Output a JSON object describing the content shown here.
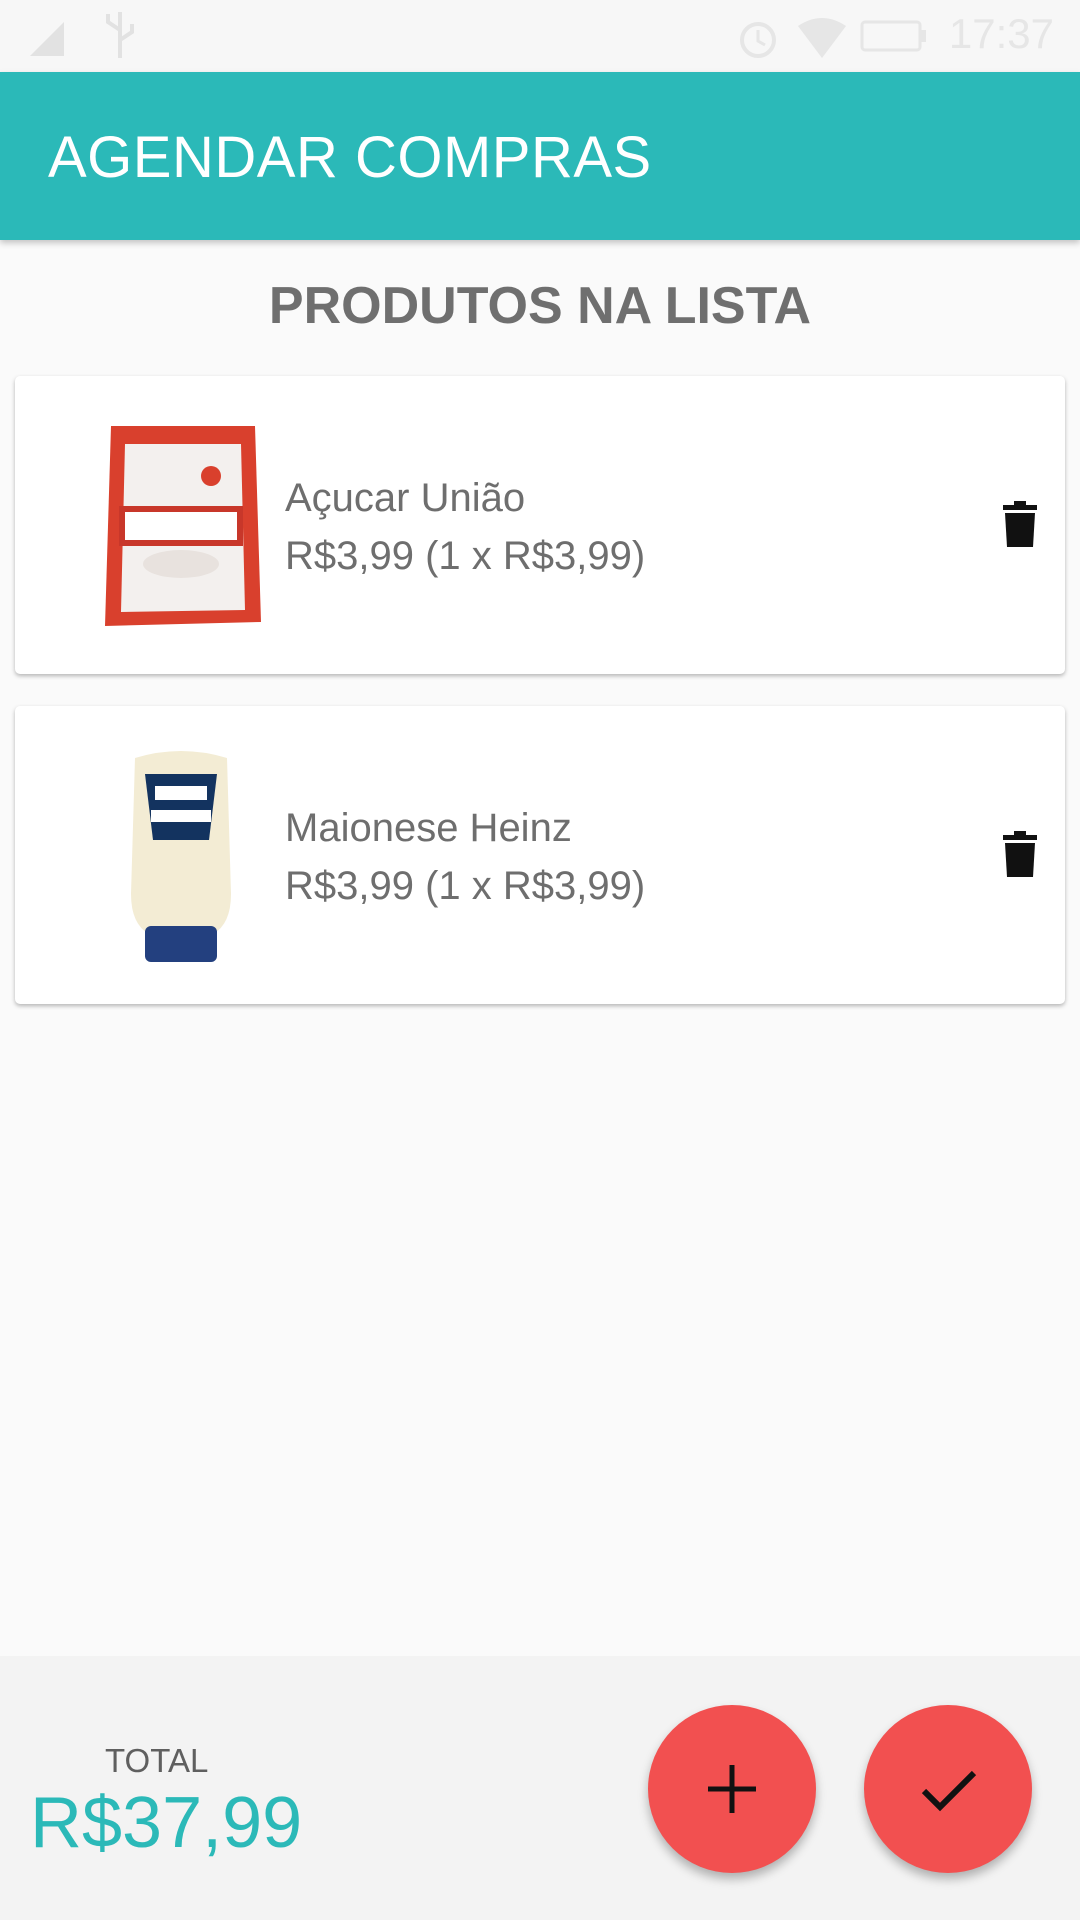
{
  "status_bar": {
    "time": "17:37",
    "icons": [
      "signal-icon",
      "usb-icon",
      "alarm-icon",
      "wifi-icon",
      "battery-icon"
    ]
  },
  "app_bar": {
    "title": "AGENDAR COMPRAS"
  },
  "list": {
    "title": "PRODUTOS NA LISTA",
    "items": [
      {
        "name": "Açucar União",
        "price": "R$3,99 (1 x R$3,99)",
        "image": "sugar-package-image",
        "action_icon": "trash-icon"
      },
      {
        "name": "Maionese Heinz",
        "price": "R$3,99 (1 x R$3,99)",
        "image": "mayonnaise-bottle-image",
        "action_icon": "trash-icon"
      }
    ]
  },
  "summary": {
    "total_label": "TOTAL",
    "total_value": "R$37,99"
  },
  "actions": {
    "add_icon": "plus-icon",
    "confirm_icon": "check-icon"
  },
  "colors": {
    "primary": "#2bb9b8",
    "fab": "#f25050",
    "text": "#6e6e6e",
    "background": "#fafafa"
  }
}
